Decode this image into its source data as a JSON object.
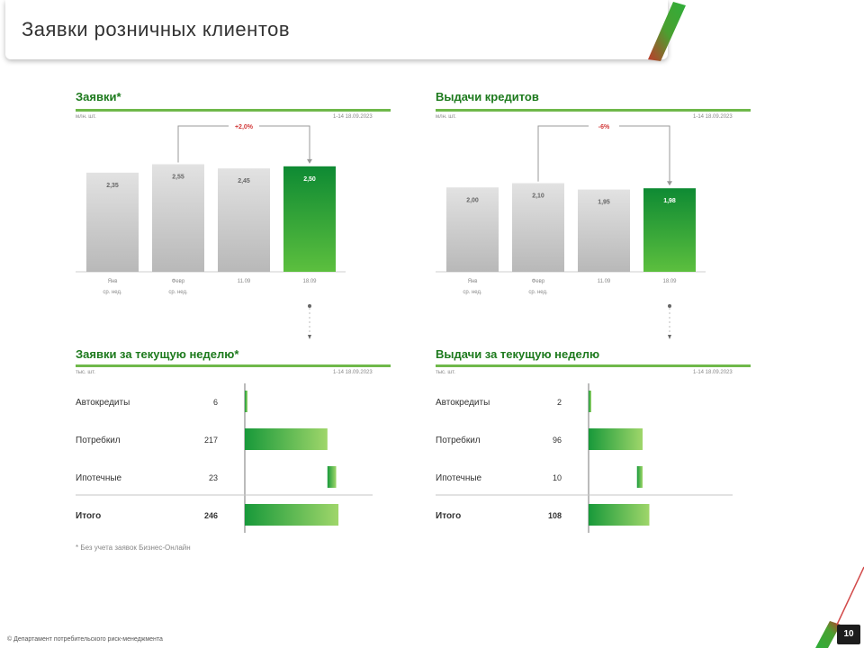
{
  "header": {
    "title": "Заявки розничных клиентов"
  },
  "colors": {
    "accent_green": "#1d9a3c",
    "rule_green": "#6fb84a",
    "gray_bar": "#c8c8c8",
    "change_red": "#d23a3a"
  },
  "chart_data": [
    {
      "type": "bar",
      "title": "Заявки*",
      "unit_label": "млн. шт.",
      "range_label": "1-14 18.09.2023",
      "categories": [
        "Янв",
        "Февр",
        "11.09",
        "18.09"
      ],
      "category_sub": [
        "ср. нед.",
        "ср. нед.",
        "",
        ""
      ],
      "values": [
        2.35,
        2.55,
        2.45,
        2.5
      ],
      "value_labels": [
        "2,35",
        "2,55",
        "2,45",
        "2,50"
      ],
      "highlight_index": 3,
      "change_label": "+2,0%",
      "change_from": 1,
      "change_to": 3,
      "ylim": [
        0,
        3.2
      ]
    },
    {
      "type": "bar",
      "title": "Выдачи кредитов",
      "unit_label": "млн. шт.",
      "range_label": "1-14 18.09.2023",
      "categories": [
        "Янв",
        "Февр",
        "11.09",
        "18.09"
      ],
      "category_sub": [
        "ср. нед.",
        "ср. нед.",
        "",
        ""
      ],
      "values": [
        2.0,
        2.1,
        1.95,
        1.98
      ],
      "value_labels": [
        "2,00",
        "2,10",
        "1,95",
        "1,98"
      ],
      "highlight_index": 3,
      "change_label": "-6%",
      "change_from": 1,
      "change_to": 3,
      "ylim": [
        0,
        3.2
      ]
    },
    {
      "type": "bar",
      "orientation": "horizontal",
      "title": "Заявки за текущую неделю*",
      "unit_label": "тыс. шт.",
      "range_label": "1-14 18.09.2023",
      "categories": [
        "Автокредиты",
        "Потребкил",
        "Ипотечные",
        "Итого"
      ],
      "values": [
        6,
        217,
        23,
        246
      ],
      "value_labels": [
        "6",
        "217",
        "23",
        "246"
      ],
      "offsets": [
        0,
        0,
        217,
        0
      ],
      "xmax": 260
    },
    {
      "type": "bar",
      "orientation": "horizontal",
      "title": "Выдачи за текущую неделю",
      "unit_label": "тыс. шт.",
      "range_label": "1-14 18.09.2023",
      "categories": [
        "Автокредиты",
        "Потребкил",
        "Ипотечные",
        "Итого"
      ],
      "values": [
        2,
        96,
        10,
        108
      ],
      "value_labels": [
        "2",
        "96",
        "10",
        "108"
      ],
      "offsets": [
        0,
        0,
        86,
        0
      ],
      "xmax": 160
    }
  ],
  "footnote": "* Без учета заявок Бизнес-Онлайн",
  "copyright": "© Департамент потребительского риск-менеджмента",
  "page_number": "10"
}
